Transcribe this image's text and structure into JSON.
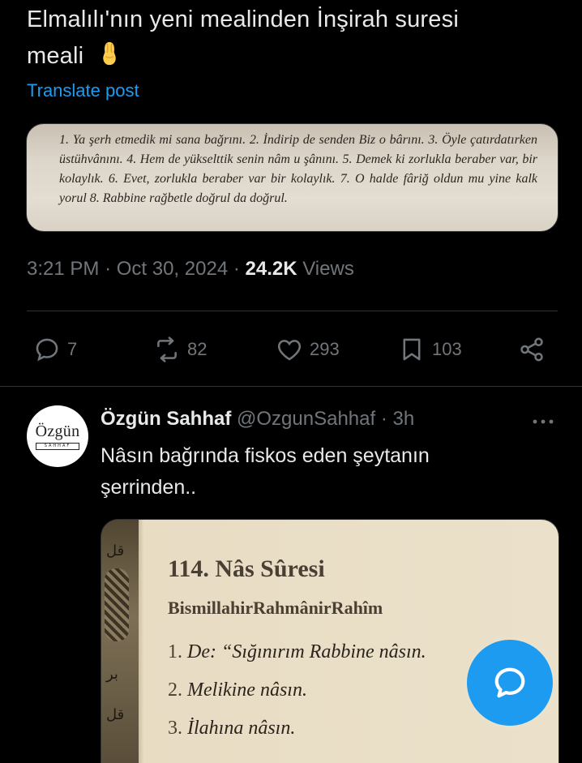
{
  "tweet": {
    "text_line1": "Elmalılı'nın yeni mealinden İnşirah suresi",
    "text_line2": "meali",
    "emoji": "pinched-fingers-emoji",
    "translate_label": "Translate post",
    "image_text": "1. Ya şerh etmedik mi sana bağrını. 2. İndirip de senden Biz o bârını. 3. Öyle çatırdatırken üstühvânını. 4. Hem de yükselttik senin nâm u şânını. 5. Demek ki zorlukla beraber var, bir kolaylık. 6. Evet, zorlukla beraber var bir kolaylık. 7. O halde fâriğ oldun mu yine kalk yorul 8. Rabbine rağbetle doğrul da doğrul.",
    "time": "3:21 PM",
    "date": "Oct 30, 2024",
    "views_count": "24.2K",
    "views_label": "Views",
    "sep": "·"
  },
  "actions": {
    "replies": "7",
    "reposts": "82",
    "likes": "293",
    "bookmarks": "103"
  },
  "reply": {
    "avatar_text": "Özgün",
    "avatar_sub": "SAHHAF",
    "name": "Özgün Sahhaf",
    "handle": "@OzgunSahhaf",
    "sep": "·",
    "time": "3h",
    "text_line1": "Nâsın bağrında fiskos eden şeytanın",
    "text_line2": "şerrinden..",
    "image": {
      "title": "114. Nâs Sûresi",
      "basmala": "BismillahirRahmânirRahîm",
      "verses": [
        {
          "num": "1.",
          "text": "De: “Sığınırım Rabbine nâsın."
        },
        {
          "num": "2.",
          "text": "Melikine nâsın."
        },
        {
          "num": "3.",
          "text": "İlahına nâsın."
        }
      ]
    }
  },
  "colors": {
    "background": "#000000",
    "text": "#e7e9ea",
    "muted": "#71767b",
    "accent": "#1d9bf0"
  },
  "icons": [
    "reply-icon",
    "repost-icon",
    "like-icon",
    "bookmark-icon",
    "share-icon",
    "more-icon",
    "compose-icon"
  ]
}
